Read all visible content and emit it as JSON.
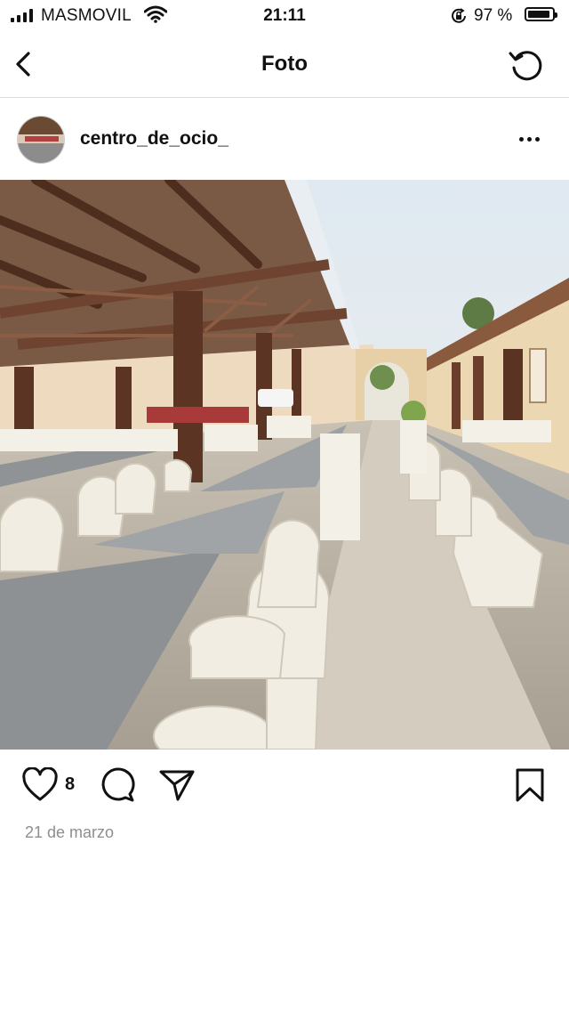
{
  "status_bar": {
    "carrier": "MASMOVIL",
    "time": "21:11",
    "battery_percent": "97 %",
    "battery_level": 0.97,
    "icons": [
      "signal-icon",
      "wifi-icon",
      "orientation-lock-icon",
      "battery-icon"
    ]
  },
  "header": {
    "title": "Foto",
    "back_icon": "chevron-left-icon",
    "refresh_icon": "refresh-icon"
  },
  "post": {
    "username": "centro_de_ocio_",
    "more_icon": "more-dots-icon",
    "photo_description_icon": "photo",
    "likes_count": "8",
    "date": "21 de marzo",
    "action_icons": [
      "heart-icon",
      "comment-icon",
      "share-icon",
      "bookmark-icon"
    ]
  }
}
